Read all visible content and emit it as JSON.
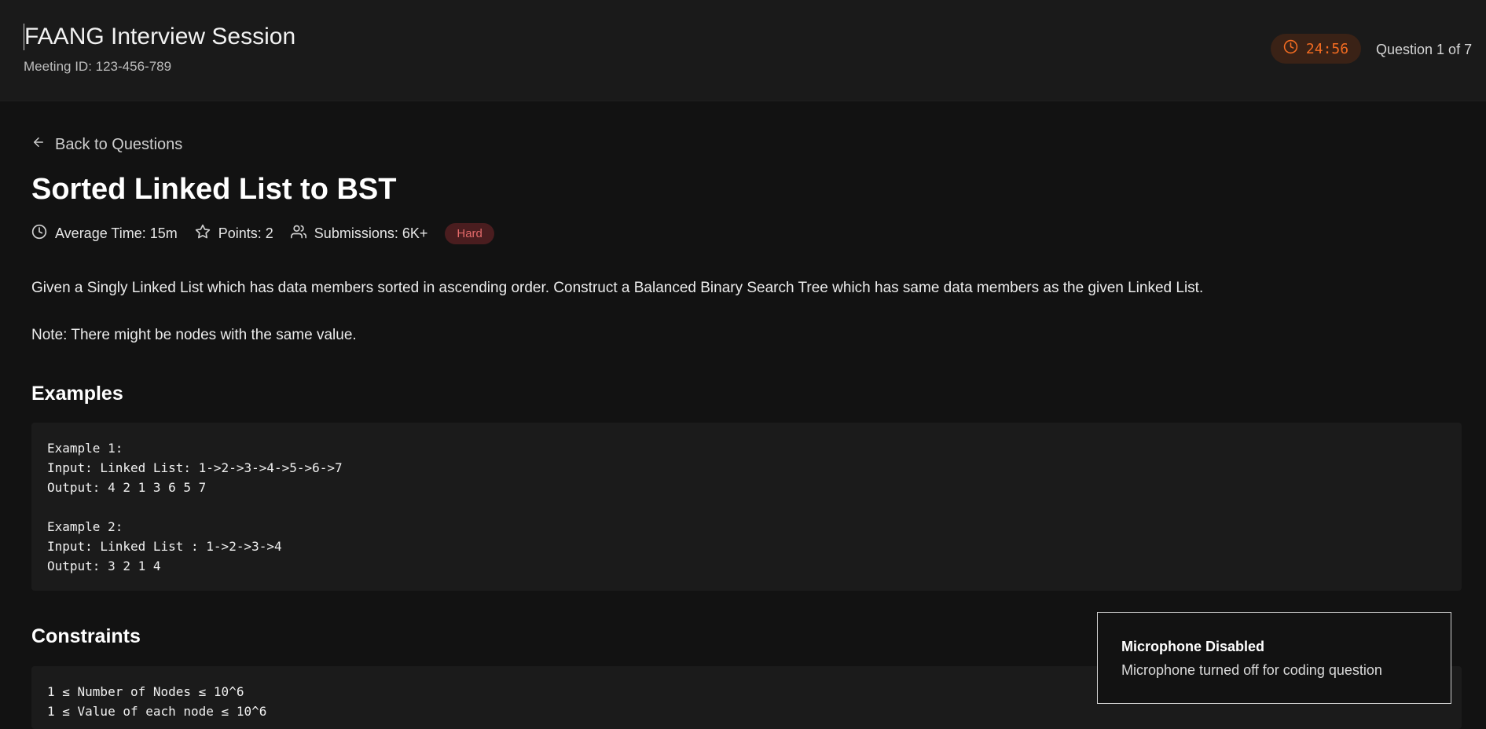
{
  "header": {
    "session_title": "FAANG Interview Session",
    "meeting_id": "Meeting ID: 123-456-789",
    "timer": "24:56",
    "question_progress": "Question 1 of 7"
  },
  "question": {
    "back_label": "Back to Questions",
    "title": "Sorted Linked List to BST",
    "meta": {
      "avg_time": "Average Time: 15m",
      "points": "Points: 2",
      "submissions": "Submissions: 6K+",
      "difficulty": "Hard"
    },
    "description": "Given a Singly Linked List which has data members sorted in ascending order. Construct a Balanced Binary Search Tree which has same data members as the given Linked List.",
    "note": "Note: There might be nodes with the same value.",
    "examples_heading": "Examples",
    "examples_code": "Example 1:\nInput: Linked List: 1->2->3->4->5->6->7\nOutput: 4 2 1 3 6 5 7\n\nExample 2:\nInput: Linked List : 1->2->3->4\nOutput: 3 2 1 4",
    "constraints_heading": "Constraints",
    "constraints_code": "1 ≤ Number of Nodes ≤ 10^6\n1 ≤ Value of each node ≤ 10^6"
  },
  "toast": {
    "title": "Microphone Disabled",
    "message": "Microphone turned off for coding question"
  },
  "colors": {
    "background": "#121212",
    "header_bg": "#1a1a1a",
    "timer_accent": "#f26b21",
    "hard_badge": "#e46a6a"
  },
  "icons": {
    "timer": "clock-icon",
    "back": "arrow-left-icon",
    "avg_time": "clock-icon",
    "points": "star-icon",
    "submissions": "users-icon"
  }
}
